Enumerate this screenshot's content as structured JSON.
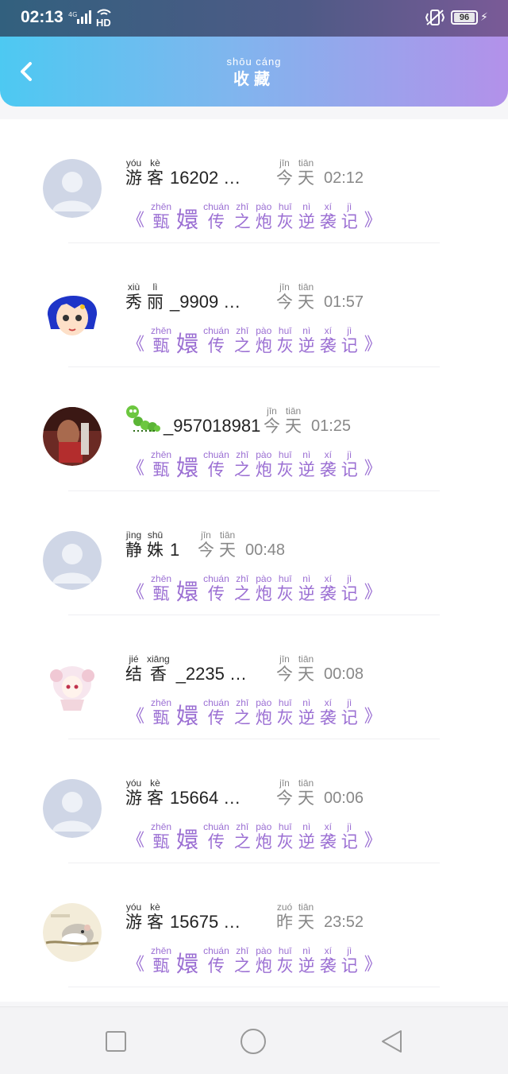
{
  "status": {
    "time": "02:13",
    "network": "4G",
    "hd": "HD",
    "battery": "96"
  },
  "header": {
    "title_pinyin": "shōu cáng",
    "title": "收藏",
    "back_icon": "chevron-left-icon"
  },
  "entry_title": {
    "left_bracket": "《",
    "right_bracket": "》",
    "chars": [
      {
        "py": "zhēn",
        "cn": "甄"
      },
      {
        "py": "",
        "cn": "嬛"
      },
      {
        "py": "chuán",
        "cn": "传"
      },
      {
        "py": "zhī",
        "cn": "之"
      },
      {
        "py": "pào",
        "cn": "炮"
      },
      {
        "py": "huī",
        "cn": "灰"
      },
      {
        "py": "nì",
        "cn": "逆"
      },
      {
        "py": "xí",
        "cn": "袭"
      },
      {
        "py": "jì",
        "cn": "记"
      }
    ]
  },
  "items": [
    {
      "name_chars": [
        {
          "py": "yóu",
          "cn": "游"
        },
        {
          "py": "kè",
          "cn": "客"
        }
      ],
      "name_rest": "16202 …",
      "day": [
        {
          "py": "jīn",
          "cn": "今"
        },
        {
          "py": "tiān",
          "cn": "天"
        }
      ],
      "time": "02:12",
      "avatar": "default-avatar"
    },
    {
      "name_chars": [
        {
          "py": "xiù",
          "cn": "秀"
        },
        {
          "py": "lì",
          "cn": "丽"
        }
      ],
      "name_rest": "_9909 …",
      "day": [
        {
          "py": "jīn",
          "cn": "今"
        },
        {
          "py": "tiān",
          "cn": "天"
        }
      ],
      "time": "01:57",
      "avatar": "anime-blue-hair-avatar"
    },
    {
      "name_chars": [],
      "name_rest": "_957018981",
      "day": [
        {
          "py": "jīn",
          "cn": "今"
        },
        {
          "py": "tiān",
          "cn": "天"
        }
      ],
      "time": "01:25",
      "avatar": "photo-avatar",
      "name_icon": "caterpillar-icon"
    },
    {
      "name_chars": [
        {
          "py": "jìng",
          "cn": "静"
        },
        {
          "py": "shū",
          "cn": "姝"
        }
      ],
      "name_rest": "1",
      "day": [
        {
          "py": "jīn",
          "cn": "今"
        },
        {
          "py": "tiān",
          "cn": "天"
        }
      ],
      "time": "00:48",
      "avatar": "default-avatar"
    },
    {
      "name_chars": [
        {
          "py": "jié",
          "cn": "结"
        },
        {
          "py": "xiāng",
          "cn": "香"
        }
      ],
      "name_rest": "_2235 …",
      "day": [
        {
          "py": "jīn",
          "cn": "今"
        },
        {
          "py": "tiān",
          "cn": "天"
        }
      ],
      "time": "00:08",
      "avatar": "anime-girl-avatar"
    },
    {
      "name_chars": [
        {
          "py": "yóu",
          "cn": "游"
        },
        {
          "py": "kè",
          "cn": "客"
        }
      ],
      "name_rest": "15664 …",
      "day": [
        {
          "py": "jīn",
          "cn": "今"
        },
        {
          "py": "tiān",
          "cn": "天"
        }
      ],
      "time": "00:06",
      "avatar": "default-avatar"
    },
    {
      "name_chars": [
        {
          "py": "yóu",
          "cn": "游"
        },
        {
          "py": "kè",
          "cn": "客"
        }
      ],
      "name_rest": "15675 …",
      "day": [
        {
          "py": "zuó",
          "cn": "昨"
        },
        {
          "py": "tiān",
          "cn": "天"
        }
      ],
      "time": "23:52",
      "avatar": "hamster-avatar"
    }
  ],
  "navbar": {
    "square": "recent-apps-icon",
    "circle": "home-icon",
    "triangle": "back-icon"
  },
  "colors": {
    "accent": "#9b6fd3",
    "gradient_start": "#4dc9f2",
    "gradient_end": "#b391ea"
  }
}
